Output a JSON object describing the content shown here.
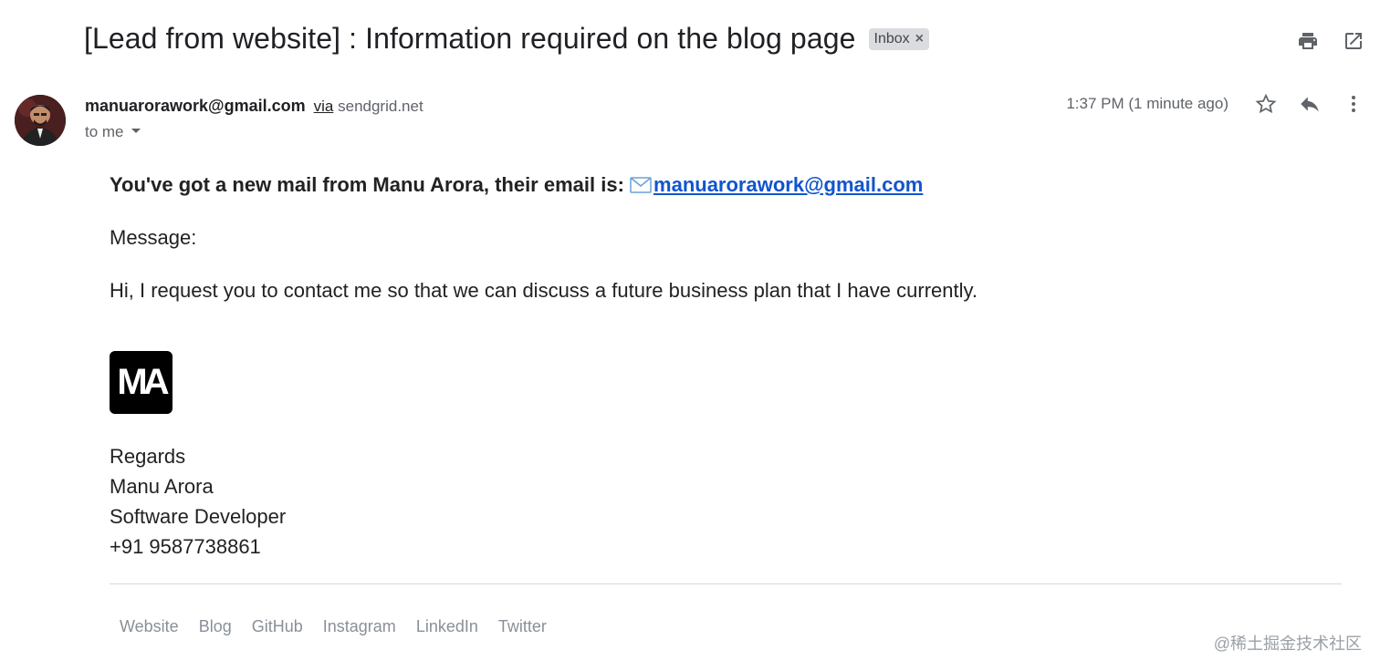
{
  "subject": "[Lead from website] : Information required on the blog page",
  "label_chip": {
    "text": "Inbox",
    "remove_glyph": "×"
  },
  "top_icons": [
    "print-icon",
    "open-in-new-window-icon"
  ],
  "sender": {
    "email": "manuarorawork@gmail.com",
    "via_label": "via",
    "via_domain": "sendgrid.net",
    "to_label": "to me"
  },
  "meta": {
    "timestamp": "1:37 PM (1 minute ago)",
    "icons": [
      "star-icon",
      "reply-icon",
      "more-vert-icon"
    ]
  },
  "message": {
    "intro": "You've got a new mail from Manu Arora, their email is: ",
    "intro_link": "manuarorawork@gmail.com",
    "label": "Message:",
    "text": "Hi, I request you to contact me so that we can discuss a future business plan that I have currently."
  },
  "logo_text": "MA",
  "signature": {
    "line1": "Regards",
    "line2": "Manu Arora",
    "line3": "Software Developer",
    "line4": "+91 9587738861"
  },
  "footer_links": [
    "Website",
    "Blog",
    "GitHub",
    "Instagram",
    "LinkedIn",
    "Twitter"
  ],
  "watermark": "@稀土掘金技术社区",
  "colors": {
    "link": "#1155cc",
    "chip": "#dadce0",
    "muted": "#5f6368",
    "footer": "#8a8f98"
  }
}
